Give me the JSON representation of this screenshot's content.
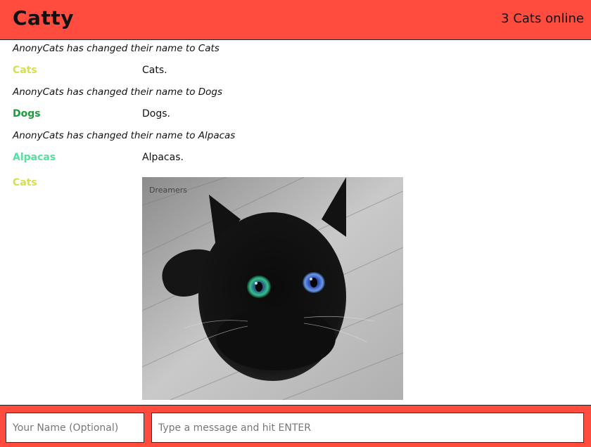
{
  "header": {
    "title": "Catty",
    "online": "3 Cats online"
  },
  "messages": [
    {
      "type": "notice",
      "text": "AnonyCats has changed their name to Cats"
    },
    {
      "type": "chat",
      "name": "Cats",
      "color": "#d6e04a",
      "text": "Cats."
    },
    {
      "type": "notice",
      "text": "AnonyCats has changed their name to Dogs"
    },
    {
      "type": "chat",
      "name": "Dogs",
      "color": "#1f9a3c",
      "text": "Dogs."
    },
    {
      "type": "notice",
      "text": "AnonyCats has changed their name to Alpacas"
    },
    {
      "type": "chat",
      "name": "Alpacas",
      "color": "#55e0a0",
      "text": "Alpacas."
    },
    {
      "type": "image",
      "name": "Cats",
      "color": "#d6e04a",
      "image_label": "Dreamers",
      "image_icon": "black-cat-photo"
    }
  ],
  "footer": {
    "name_placeholder": "Your Name (Optional)",
    "message_placeholder": "Type a message and hit ENTER"
  },
  "colors": {
    "brand": "#ff4c3e"
  }
}
